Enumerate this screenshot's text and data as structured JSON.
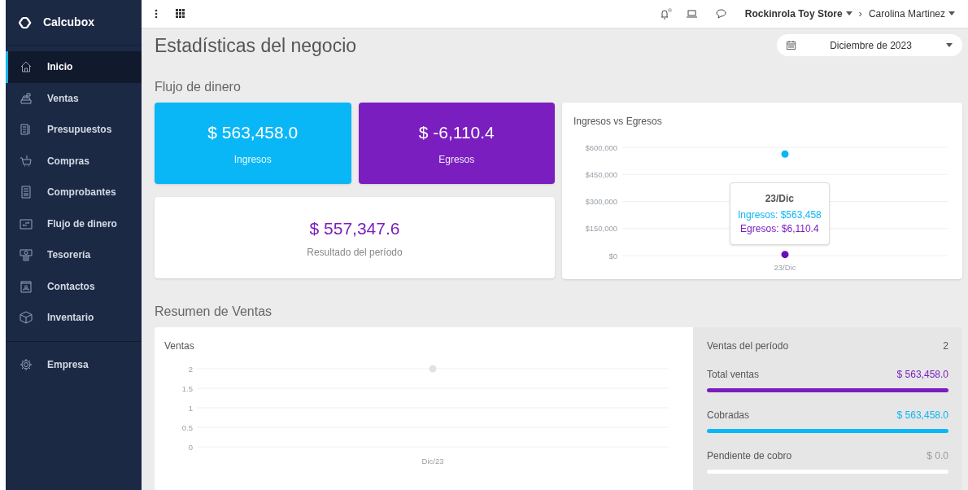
{
  "sidebar": {
    "logo": "Calcubox",
    "items": [
      {
        "label": "Inicio",
        "selected": true
      },
      {
        "label": "Ventas",
        "selected": false
      },
      {
        "label": "Presupuestos",
        "selected": false
      },
      {
        "label": "Compras",
        "selected": false
      },
      {
        "label": "Comprobantes",
        "selected": false
      },
      {
        "label": "Flujo de dinero",
        "selected": false
      },
      {
        "label": "Tesorería",
        "selected": false
      },
      {
        "label": "Contactos",
        "selected": false
      },
      {
        "label": "Inventario",
        "selected": false
      }
    ],
    "bottom_items": [
      {
        "label": "Empresa",
        "selected": false
      }
    ]
  },
  "topbar": {
    "store": "Rockinrola Toy Store",
    "separator": "›",
    "user": "Carolina Martinez"
  },
  "page_title": "Estadísticas del negocio",
  "period_select": {
    "value": "Diciembre de 2023"
  },
  "cash_flow": {
    "heading": "Flujo de dinero",
    "cards": [
      {
        "amount": "$ 563,458.0",
        "label": "Ingresos",
        "color": "#0ab7f6"
      },
      {
        "amount": "$ -6,110.4",
        "label": "Egresos",
        "color": "#7a1ebf"
      }
    ],
    "result": {
      "amount": "$ 557,347.6",
      "label": "Resultado del período"
    },
    "chart": {
      "title": "Ingresos vs Egresos",
      "chart_data": {
        "type": "scatter",
        "grid": true,
        "categories": [
          "23/Dic"
        ],
        "ylim": [
          0,
          600000
        ],
        "yticks": [
          {
            "value": 0,
            "label": "$0"
          },
          {
            "value": 150000,
            "label": "$150,000"
          },
          {
            "value": 300000,
            "label": "$300,000"
          },
          {
            "value": 450000,
            "label": "$450,000"
          },
          {
            "value": 600000,
            "label": "$600,000"
          }
        ],
        "series": [
          {
            "color": "#0ab7f6",
            "values": [
              563000
            ]
          },
          {
            "color": "#6a0dbb",
            "values": [
              6000
            ]
          }
        ]
      },
      "tooltip": {
        "title": "23/Dic",
        "lines": [
          {
            "text": "Ingresos: $563,458",
            "color": "#0ab7f6"
          },
          {
            "text": "Egresos: $6,110.4",
            "color": "#7a1ebf"
          }
        ]
      }
    }
  },
  "sales": {
    "heading": "Resumen de Ventas",
    "chart": {
      "title": "Ventas",
      "chart_data": {
        "type": "scatter",
        "grid": true,
        "categories": [
          "Dic/23"
        ],
        "ylim": [
          0,
          2
        ],
        "yticks": [
          0,
          0.5,
          1,
          1.5,
          2
        ],
        "series": [
          {
            "color": "#dfe3e8",
            "values": [
              2
            ]
          }
        ]
      }
    },
    "summary": [
      {
        "kind": "count",
        "label": "Ventas del período",
        "value": "2"
      },
      {
        "kind": "bar",
        "label": "Total ventas",
        "value": "$ 563,458.0",
        "color": "#7a1ebf",
        "level": 1
      },
      {
        "kind": "bar",
        "label": "Cobradas",
        "value": "$ 563,458.0",
        "color": "#0ab7f6",
        "level": 1
      },
      {
        "kind": "bar",
        "label": "Pendiente de cobro",
        "value": "$ 0.0",
        "color": "#9a9a9a",
        "level": 0
      }
    ]
  }
}
